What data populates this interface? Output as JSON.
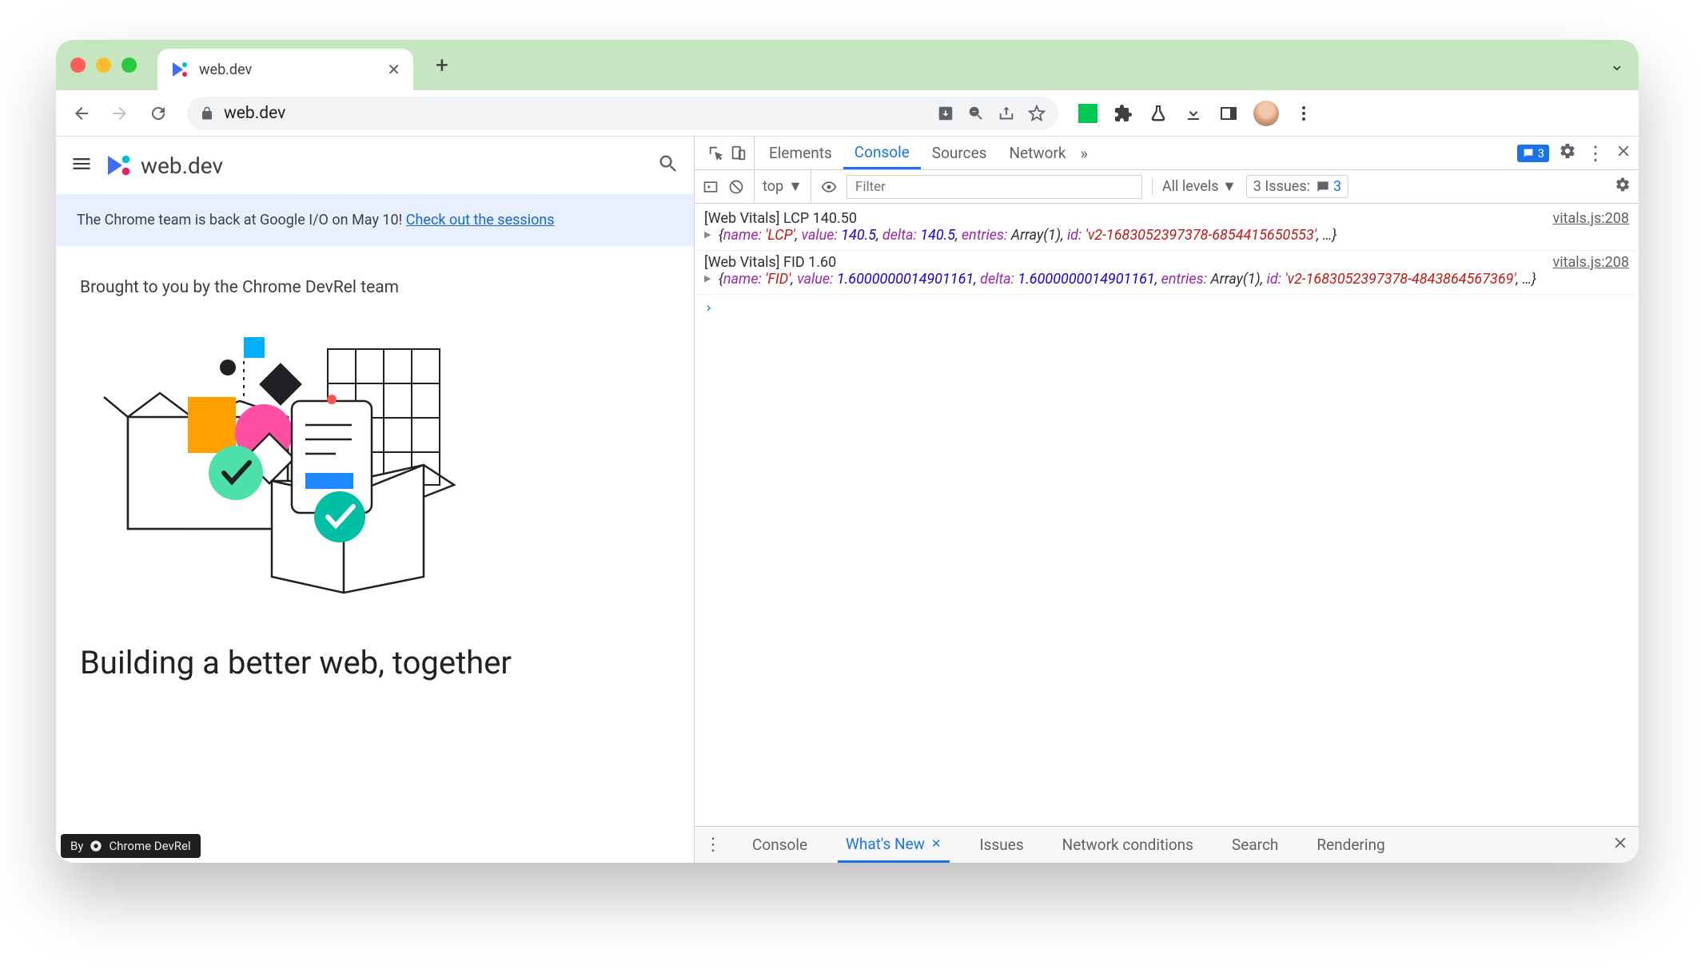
{
  "chrome": {
    "tab_title": "web.dev",
    "url": "web.dev",
    "traffic": {
      "red": "#ff5f57",
      "yellow": "#febc2e",
      "green": "#28c840"
    }
  },
  "page": {
    "site_name": "web.dev",
    "banner_text": "The Chrome team is back at Google I/O on May 10! ",
    "banner_link": "Check out the sessions",
    "hero_subtitle": "Brought to you by the Chrome DevRel team",
    "hero_heading": "Building a better web, together",
    "attribution_prefix": "By",
    "attribution_name": "Chrome DevRel"
  },
  "devtools": {
    "tabs": [
      "Elements",
      "Console",
      "Sources",
      "Network"
    ],
    "active_tab": "Console",
    "more_glyph": "»",
    "messages_badge": "3",
    "console_bar": {
      "context": "top",
      "filter_placeholder": "Filter",
      "levels_label": "All levels",
      "issues_label": "3 Issues:",
      "issues_count": "3"
    },
    "logs": [
      {
        "head": "[Web Vitals] LCP 140.50",
        "src": "vitals.js:208",
        "obj_parts": [
          {
            "t": "punc",
            "v": "{"
          },
          {
            "t": "lbl",
            "v": "name:"
          },
          {
            "t": "punc",
            "v": " "
          },
          {
            "t": "str",
            "v": "'LCP'"
          },
          {
            "t": "punc",
            "v": ", "
          },
          {
            "t": "lbl",
            "v": "value:"
          },
          {
            "t": "punc",
            "v": " "
          },
          {
            "t": "num",
            "v": "140.5"
          },
          {
            "t": "punc",
            "v": ", "
          },
          {
            "t": "lbl",
            "v": "delta:"
          },
          {
            "t": "punc",
            "v": " "
          },
          {
            "t": "num",
            "v": "140.5"
          },
          {
            "t": "punc",
            "v": ", "
          },
          {
            "t": "lbl",
            "v": "entries:"
          },
          {
            "t": "punc",
            "v": " Array(1), "
          },
          {
            "t": "lbl",
            "v": "id:"
          },
          {
            "t": "punc",
            "v": " "
          },
          {
            "t": "str",
            "v": "'v2-1683052397378-6854415650553'"
          },
          {
            "t": "punc",
            "v": ", …}"
          }
        ]
      },
      {
        "head": "[Web Vitals] FID 1.60",
        "src": "vitals.js:208",
        "obj_parts": [
          {
            "t": "punc",
            "v": "{"
          },
          {
            "t": "lbl",
            "v": "name:"
          },
          {
            "t": "punc",
            "v": " "
          },
          {
            "t": "str",
            "v": "'FID'"
          },
          {
            "t": "punc",
            "v": ", "
          },
          {
            "t": "lbl",
            "v": "value:"
          },
          {
            "t": "punc",
            "v": " "
          },
          {
            "t": "num",
            "v": "1.6000000014901161"
          },
          {
            "t": "punc",
            "v": ", "
          },
          {
            "t": "lbl",
            "v": "delta:"
          },
          {
            "t": "punc",
            "v": " "
          },
          {
            "t": "num",
            "v": "1.6000000014901161"
          },
          {
            "t": "punc",
            "v": ", "
          },
          {
            "t": "lbl",
            "v": "entries:"
          },
          {
            "t": "punc",
            "v": " Array(1), "
          },
          {
            "t": "lbl",
            "v": "id:"
          },
          {
            "t": "punc",
            "v": " "
          },
          {
            "t": "str",
            "v": "'v2-1683052397378-4843864567369'"
          },
          {
            "t": "punc",
            "v": ", …}"
          }
        ]
      }
    ],
    "prompt_glyph": "›",
    "drawer_tabs": [
      "Console",
      "What's New",
      "Issues",
      "Network conditions",
      "Search",
      "Rendering"
    ],
    "drawer_active": "What's New"
  }
}
